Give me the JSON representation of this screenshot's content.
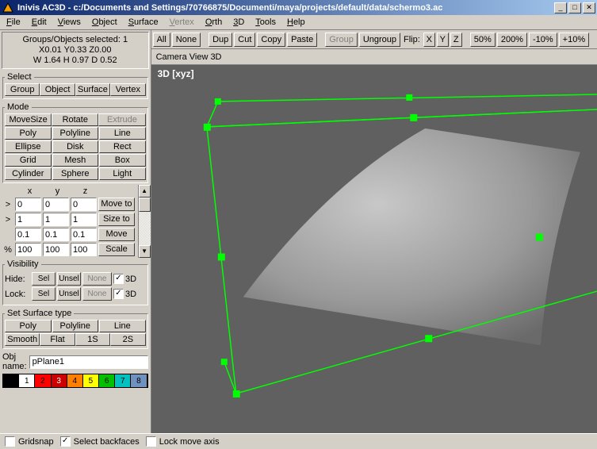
{
  "title": "Inivis AC3D - c:/Documents and Settings/70766875/Documenti/maya/projects/default/data/schermo3.ac",
  "menus": [
    "File",
    "Edit",
    "Views",
    "Object",
    "Surface",
    "Vertex",
    "Orth",
    "3D",
    "Tools",
    "Help"
  ],
  "menu_disabled_index": 5,
  "info": {
    "line1": "Groups/Objects selected: 1",
    "line2": "X0.01 Y0.33 Z0.00",
    "line3": "W 1.64 H 0.97 D 0.52"
  },
  "select": {
    "legend": "Select",
    "buttons": [
      "Group",
      "Object",
      "Surface",
      "Vertex"
    ]
  },
  "mode": {
    "legend": "Mode",
    "top": [
      "MoveSize",
      "Rotate",
      "Extrude"
    ],
    "grid": [
      "Poly",
      "Polyline",
      "Line",
      "Ellipse",
      "Disk",
      "Rect",
      "Grid",
      "Mesh",
      "Box",
      "Cylinder",
      "Sphere",
      "Light"
    ],
    "disabled_index": 2
  },
  "xyz": {
    "headers": [
      "x",
      "y",
      "z"
    ],
    "rows": [
      {
        "lead": ">",
        "v": [
          "0",
          "0",
          "0"
        ],
        "btn": "Move to"
      },
      {
        "lead": ">",
        "v": [
          "1",
          "1",
          "1"
        ],
        "btn": "Size to"
      },
      {
        "lead": "",
        "v": [
          "0.1",
          "0.1",
          "0.1"
        ],
        "btn": "Move"
      },
      {
        "lead": "%",
        "v": [
          "100",
          "100",
          "100"
        ],
        "btn": "Scale"
      }
    ]
  },
  "visibility": {
    "legend": "Visibility",
    "rows": [
      {
        "label": "Hide:",
        "b": [
          "Sel",
          "Unsel",
          "None"
        ],
        "chk": "3D",
        "none_disabled": true
      },
      {
        "label": "Lock:",
        "b": [
          "Sel",
          "Unsel",
          "None"
        ],
        "chk": "3D",
        "none_disabled": true
      }
    ]
  },
  "sst": {
    "legend": "Set Surface type",
    "top": [
      "Poly",
      "Polyline",
      "Line"
    ],
    "bot": [
      "Smooth",
      "Flat",
      "1S",
      "2S"
    ]
  },
  "objname": {
    "label": "Obj name:",
    "value": "pPlane1"
  },
  "palette": [
    {
      "bg": "#000000",
      "fg": "#ffffff",
      "n": ""
    },
    {
      "bg": "#ffffff",
      "fg": "#000000",
      "n": "1"
    },
    {
      "bg": "#ff0000",
      "fg": "#000000",
      "n": "2"
    },
    {
      "bg": "#cc0000",
      "fg": "#ffffff",
      "n": "3"
    },
    {
      "bg": "#ff8000",
      "fg": "#000000",
      "n": "4"
    },
    {
      "bg": "#ffff00",
      "fg": "#000000",
      "n": "5"
    },
    {
      "bg": "#00c000",
      "fg": "#000000",
      "n": "6"
    },
    {
      "bg": "#00c0c0",
      "fg": "#000000",
      "n": "7"
    },
    {
      "bg": "#7090c0",
      "fg": "#000000",
      "n": "8"
    }
  ],
  "toolbar": {
    "sel": [
      "All",
      "None"
    ],
    "edit": [
      "Dup",
      "Cut",
      "Copy",
      "Paste"
    ],
    "grp": [
      "Group",
      "Ungroup"
    ],
    "flip_label": "Flip:",
    "flip": [
      "X",
      "Y",
      "Z"
    ],
    "zoom": [
      "50%",
      "200%",
      "-10%",
      "+10%"
    ]
  },
  "view": {
    "header": "Camera  View  3D",
    "label": "3D [xyz]"
  },
  "status": {
    "gridsnap": "Gridsnap",
    "gridsnap_checked": false,
    "backfaces": "Select backfaces",
    "backfaces_checked": true,
    "lockmove": "Lock move axis",
    "lockmove_checked": false
  }
}
